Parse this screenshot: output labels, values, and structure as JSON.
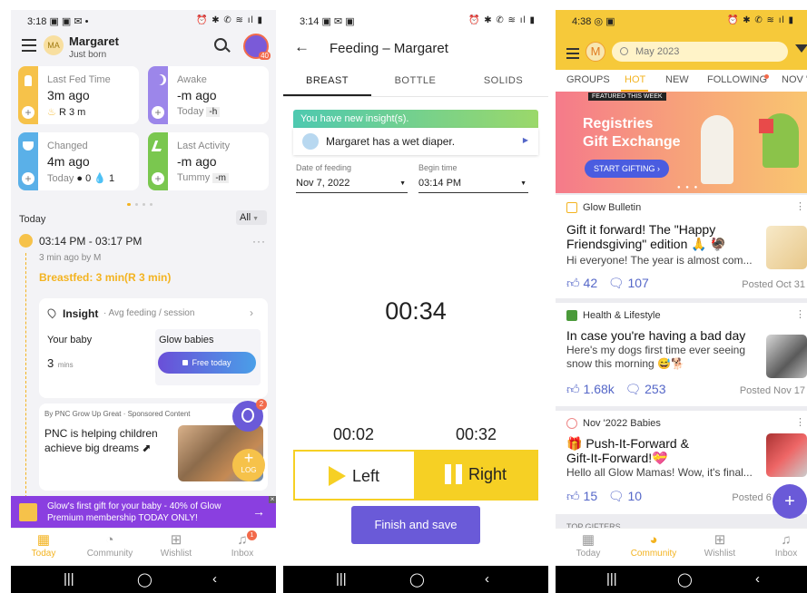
{
  "panel1": {
    "status": {
      "time": "3:18 ▣ ▣ ✉ •",
      "icons": "⏰ ✱ ✆ ≋ ıl ▮"
    },
    "header": {
      "avatar_initials": "MA",
      "name": "Margaret",
      "subtitle": "Just born",
      "badge": "40"
    },
    "tiles": [
      {
        "label": "Last Fed Time",
        "value": "3m ago",
        "sub_prefix": "♨",
        "sub_value": "R 3 m",
        "color": "#f6c24a",
        "icon": "bottle-icon"
      },
      {
        "label": "Awake",
        "value": "-m ago",
        "sub_prefix": "Today",
        "sub_value": "-h",
        "color": "#9c86ea",
        "icon": "moon-icon"
      },
      {
        "label": "Changed",
        "value": "4m ago",
        "sub_prefix": "Today",
        "sub_value": "● 0  💧 1",
        "color": "#5ab0e8",
        "icon": "diaper-icon"
      },
      {
        "label": "Last Activity",
        "value": "-m ago",
        "sub_prefix": "Tummy",
        "sub_value": "-m",
        "color": "#7ac74f",
        "icon": "activity-icon"
      }
    ],
    "timeline": {
      "day_label": "Today",
      "filter": "All",
      "entry_time": "03:14 PM - 03:17 PM",
      "entry_meta": "3 min ago by M",
      "entry_detail": "Breastfed: 3 min(R 3 min)"
    },
    "insight": {
      "title": "Insight",
      "subtitle": "· Avg feeding / session",
      "your_baby_label": "Your baby",
      "your_baby_value": "3",
      "your_baby_unit": "mins",
      "glow_label": "Glow babies",
      "free_button": "Free today"
    },
    "sponsored": {
      "header": "By PNC Grow Up Great · Sponsored Content",
      "title": "PNC is helping children achieve big dreams ⬈",
      "notif_count": "2",
      "log_label": "LOG"
    },
    "promo": "Glow's first gift for your baby - 40% of Glow Premium membership TODAY ONLY!",
    "nav": [
      {
        "label": "Today",
        "icon": "calendar-icon"
      },
      {
        "label": "Community",
        "icon": "community-icon"
      },
      {
        "label": "Wishlist",
        "icon": "gift-icon"
      },
      {
        "label": "Inbox",
        "icon": "bell-icon",
        "badge": "1"
      }
    ]
  },
  "panel2": {
    "status": {
      "time": "3:14 ▣ ✉ ▣",
      "icons": "⏰ ✱ ✆ ≋ ıl ▮"
    },
    "title": "Feeding – Margaret",
    "tabs": [
      "BREAST",
      "BOTTLE",
      "SOLIDS"
    ],
    "insight_banner": "You have new insight(s).",
    "insight_text": "Margaret has a wet diaper.",
    "date_label": "Date of feeding",
    "date_value": "Nov 7, 2022",
    "time_label": "Begin time",
    "time_value": "03:14 PM",
    "timer": "00:34",
    "left_timer": "00:02",
    "right_timer": "00:32",
    "left_label": "Left",
    "right_label": "Right",
    "finish_button": "Finish and save"
  },
  "panel3": {
    "status": {
      "time": "4:38 ◎ ▣",
      "icons": "⏰ ✱ ✆ ≋ ıl ▮"
    },
    "avatar_initial": "M",
    "search_placeholder": "May 2023",
    "tabs": [
      "GROUPS",
      "HOT",
      "NEW",
      "FOLLOWING",
      "NOV '"
    ],
    "featured_tag": "FEATURED THIS WEEK",
    "banner_title_1": "Registries",
    "banner_title_2": "Gift Exchange",
    "banner_button": "START GIFTING ›",
    "posts": [
      {
        "source": "Glow Bulletin",
        "title": "Gift it forward! The \"Happy Friendsgiving\" edition 🙏 🦃",
        "preview": "Hi everyone! The year is almost com...",
        "likes": "42",
        "comments": "107",
        "posted": "Posted Oct 31"
      },
      {
        "source": "Health & Lifestyle",
        "title": "In case you're having a bad day",
        "preview": "Here's my dogs first time ever seeing snow this morning 😅🐕",
        "likes": "1.68k",
        "comments": "253",
        "posted": "Posted Nov 17"
      },
      {
        "source": "Nov '2022 Babies",
        "title": "🎁 Push-It-Forward & Gift-It-Forward!💝",
        "preview": "Hello all Glow Mamas! Wow, it's final...",
        "likes": "15",
        "comments": "10",
        "posted": "Posted 6 d"
      }
    ],
    "section_peek": "TOP GIFTERS",
    "nav": [
      {
        "label": "Today",
        "icon": "calendar-icon"
      },
      {
        "label": "Community",
        "icon": "community-icon"
      },
      {
        "label": "Wishlist",
        "icon": "gift-icon"
      },
      {
        "label": "Inbox",
        "icon": "bell-icon"
      }
    ]
  },
  "colors": {
    "accent_yellow": "#f6d024",
    "accent_purple": "#6a5ad8",
    "community_orange": "#f3b320",
    "link_blue": "#5567c8"
  }
}
